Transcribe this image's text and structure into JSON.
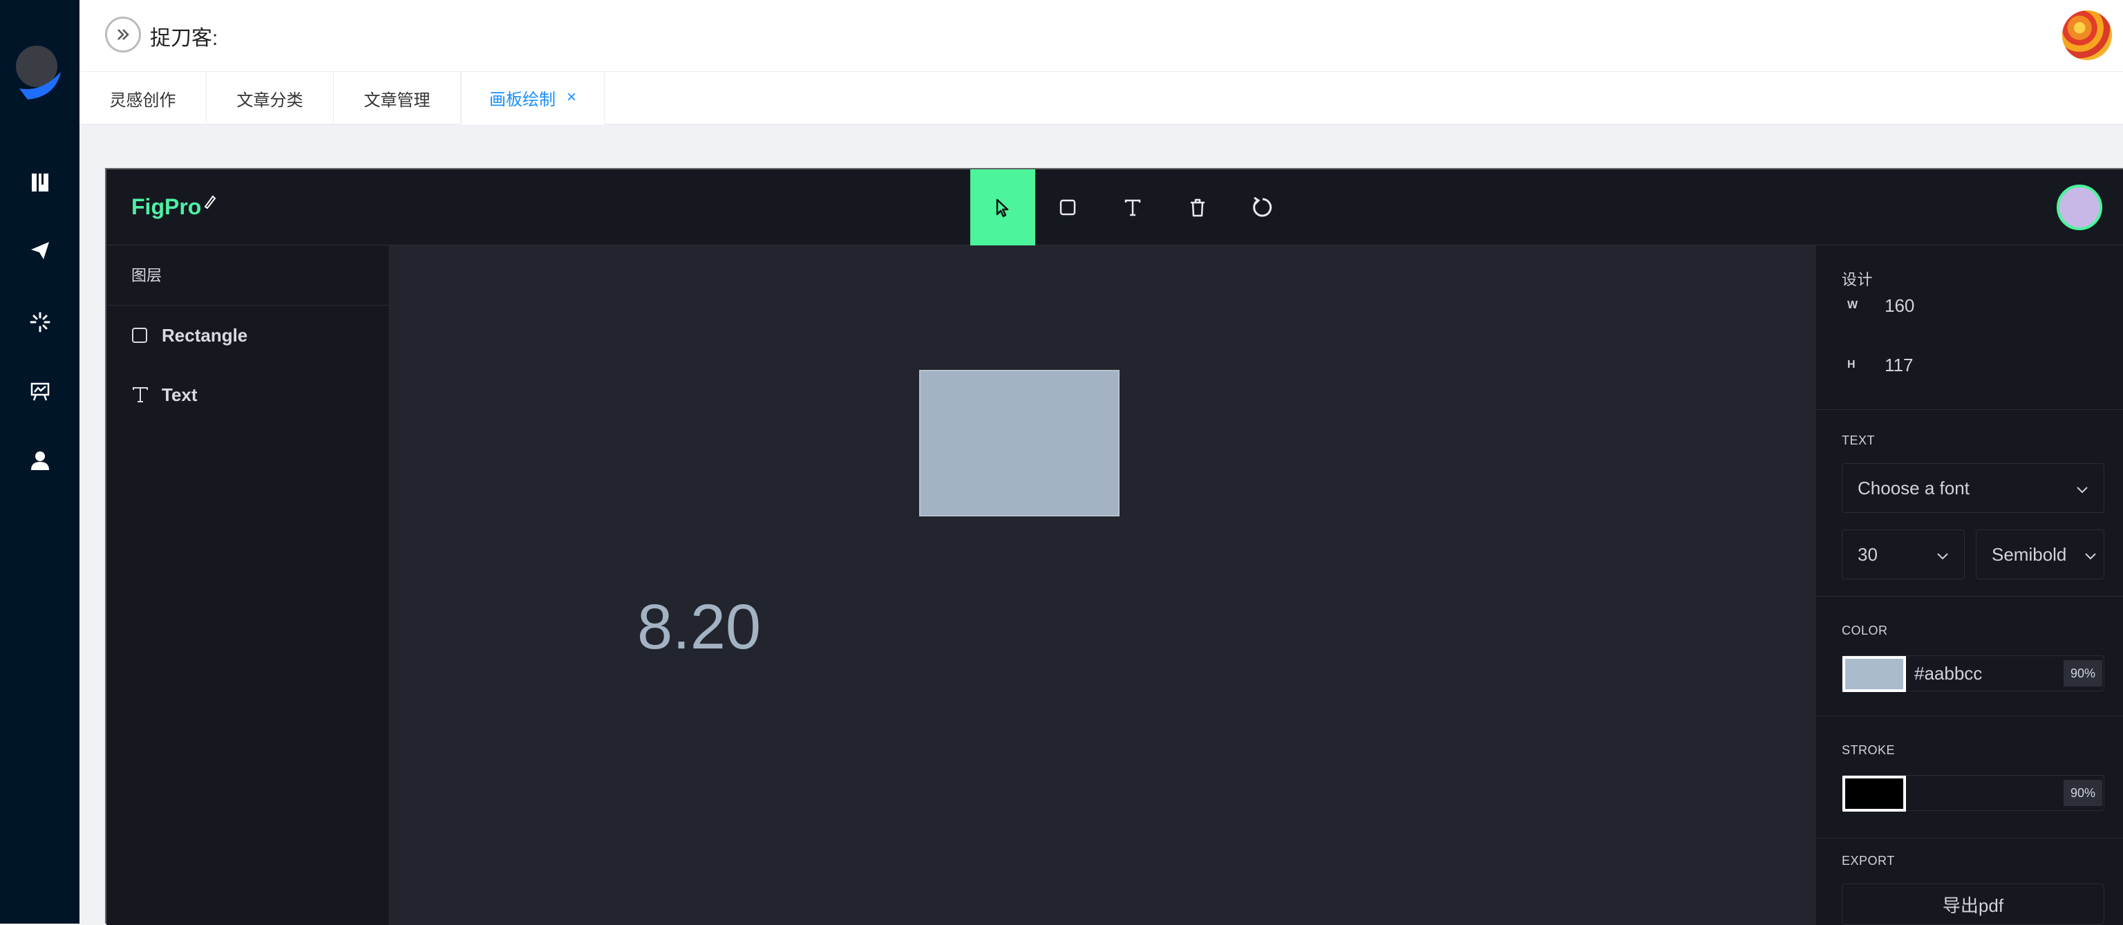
{
  "header": {
    "title": "捉刀客:"
  },
  "tabs": [
    {
      "label": "灵感创作"
    },
    {
      "label": "文章分类"
    },
    {
      "label": "文章管理"
    },
    {
      "label": "画板绘制",
      "close": "×"
    }
  ],
  "editor": {
    "brand": "FigPro",
    "tools": [
      "cursor-icon",
      "rectangle-icon",
      "text-icon",
      "trash-icon",
      "reset-icon"
    ],
    "accent": "#4cf59c"
  },
  "layers": {
    "heading": "图层",
    "items": [
      {
        "label": "Rectangle",
        "icon": "square-outline-icon"
      },
      {
        "label": "Text",
        "icon": "text-icon"
      }
    ]
  },
  "canvas": {
    "text_value": "8.20",
    "fill": "#aabbcc"
  },
  "design": {
    "heading": "设计",
    "w_label": "W",
    "w_value": "160",
    "h_label": "H",
    "h_value": "117"
  },
  "text_props": {
    "heading": "TEXT",
    "font_placeholder": "Choose a font",
    "size": "30",
    "weight": "Semibold",
    "caret": "⌵"
  },
  "color": {
    "heading": "COLOR",
    "hex": "#aabbcc",
    "opacity": "90%"
  },
  "stroke": {
    "heading": "STROKE",
    "color": "#000000",
    "opacity": "90%"
  },
  "export": {
    "heading": "EXPORT",
    "button": "导出pdf"
  }
}
